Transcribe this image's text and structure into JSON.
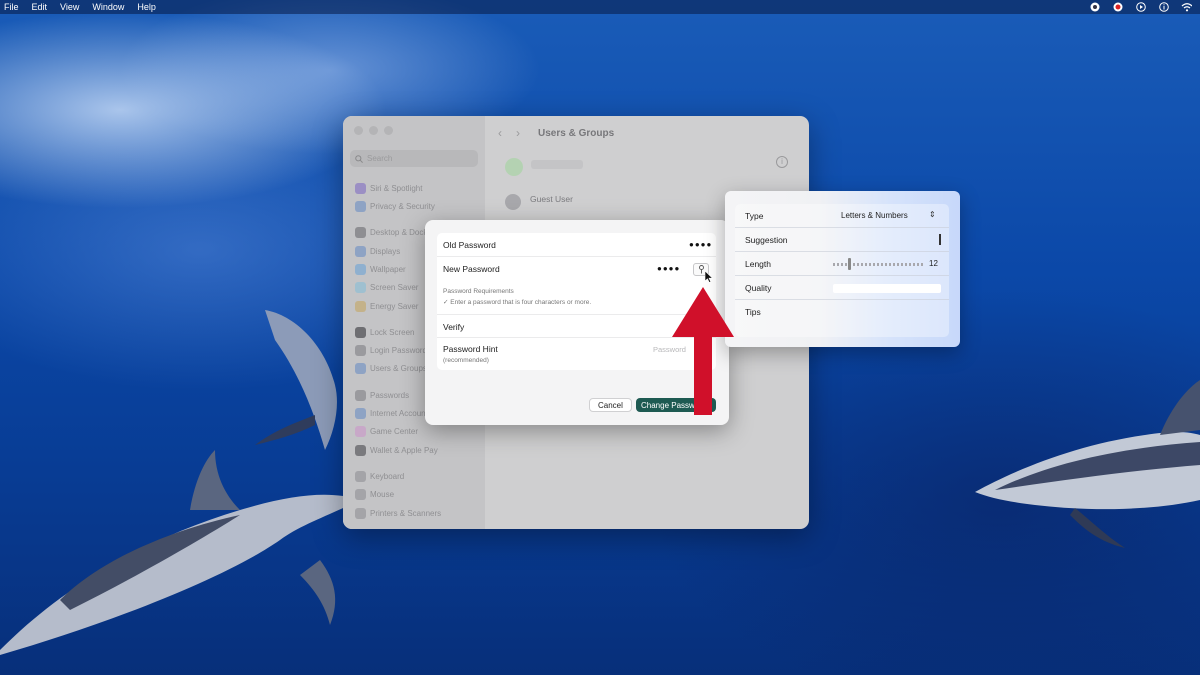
{
  "menubar": {
    "items": [
      "File",
      "Edit",
      "View",
      "Window",
      "Help"
    ],
    "status_icons": [
      "record-icon",
      "creative-cloud-icon",
      "play-icon",
      "info-icon",
      "wifi-icon"
    ]
  },
  "settings": {
    "search_placeholder": "Search",
    "title": "Users & Groups",
    "sidebar_items": [
      "Siri & Spotlight",
      "Privacy & Security",
      "Desktop & Dock",
      "Displays",
      "Wallpaper",
      "Screen Saver",
      "Energy Saver",
      "Lock Screen",
      "Login Password",
      "Users & Groups",
      "Passwords",
      "Internet Accounts",
      "Game Center",
      "Wallet & Apple Pay",
      "Keyboard",
      "Mouse",
      "Printers & Scanners"
    ],
    "guest_user": "Guest User"
  },
  "dialog": {
    "old_password_label": "Old Password",
    "old_password_value": "●●●●",
    "new_password_label": "New Password",
    "new_password_value": "●●●●",
    "requirements_title": "Password Requirements",
    "requirement": "✓ Enter a password that is four characters or more.",
    "verify_label": "Verify",
    "hint_label": "Password Hint",
    "hint_sub": "(recommended)",
    "hint_placeholder": "Password",
    "cancel": "Cancel",
    "change": "Change Password"
  },
  "assistant": {
    "type_label": "Type",
    "type_value": "Letters & Numbers",
    "suggestion_label": "Suggestion",
    "length_label": "Length",
    "length_value": "12",
    "quality_label": "Quality",
    "tips_label": "Tips"
  },
  "colors": {
    "primary_button": "#1e5a52",
    "arrow": "#d0102a"
  }
}
